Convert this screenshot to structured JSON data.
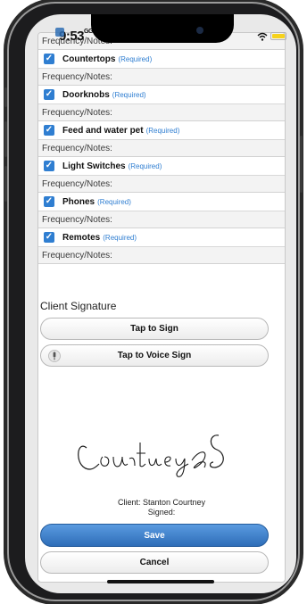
{
  "status_bar": {
    "time": "9:53",
    "time_suffix": "GG"
  },
  "checklist": {
    "frequency_label": "Frequency/Notes:",
    "required_label": "(Required)",
    "items": [
      {
        "name": "Countertops",
        "checked": true
      },
      {
        "name": "Doorknobs",
        "checked": true
      },
      {
        "name": "Feed and water pet",
        "checked": true
      },
      {
        "name": "Light Switches",
        "checked": true
      },
      {
        "name": "Phones",
        "checked": true
      },
      {
        "name": "Remotes",
        "checked": true
      }
    ]
  },
  "signature": {
    "section_label": "Client Signature",
    "tap_to_sign_label": "Tap to Sign",
    "voice_sign_label": "Tap to Voice Sign",
    "signature_image_text": "CourtneyS",
    "client_line": "Client: Stanton Courtney",
    "signed_line": "Signed:"
  },
  "actions": {
    "save_label": "Save",
    "cancel_label": "Cancel"
  },
  "colors": {
    "accent": "#2f7ed1",
    "save_button": "#3f80c8",
    "battery": "#f6d21b"
  }
}
